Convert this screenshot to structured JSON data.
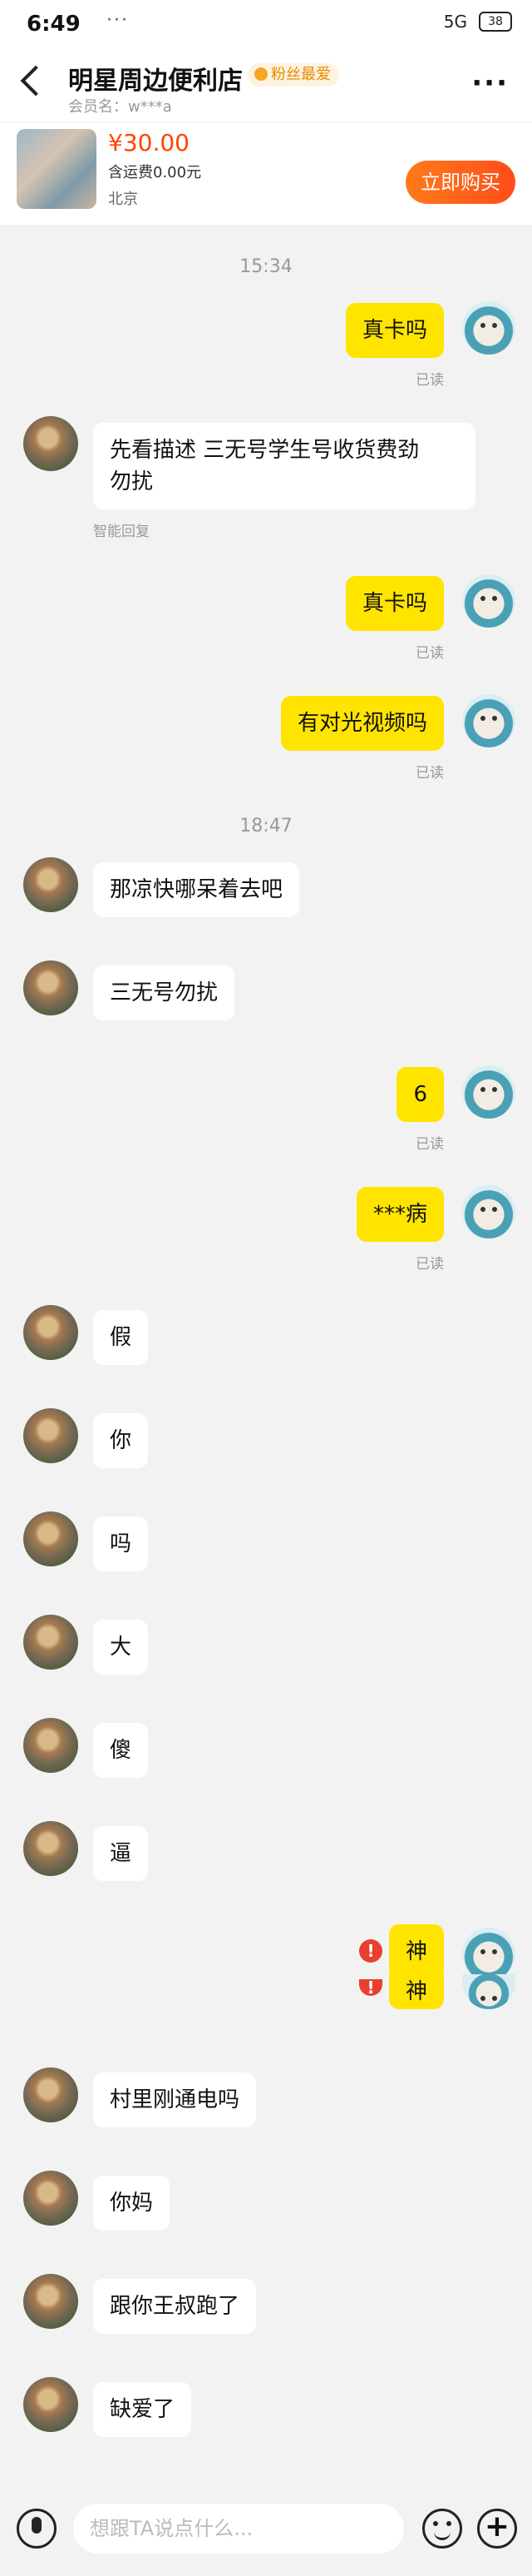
{
  "status_bar": {
    "time": "6:49",
    "extra": "··· ",
    "signal": "5G",
    "battery": "38"
  },
  "header": {
    "title": "明星周边便利店",
    "fan_badge": "粉丝最爱",
    "member": "会员名：w***a",
    "more": "···"
  },
  "product": {
    "price": "¥30.00",
    "shipping": "含运费0.00元",
    "location": "北京",
    "buy_label": "立即购买"
  },
  "chat": {
    "ts1": "15:34",
    "ts2": "18:47",
    "read": "已读",
    "auto_tag": "智能回复",
    "error_mark": "!",
    "m1": "真卡吗",
    "m2": "先看描述 三无号学生号收货费劲\n勿扰",
    "m3": "真卡吗",
    "m4": "有对光视频吗",
    "m5": "那凉快哪呆着去吧",
    "m6": "三无号勿扰",
    "m7": "6",
    "m8": "***病",
    "m9": "假",
    "m10": "你",
    "m11": "吗",
    "m12": "大",
    "m13": "傻",
    "m14": "逼",
    "m15": "神",
    "m16": "神",
    "m17": "村里刚通电吗",
    "m18": "你妈",
    "m19": "跟你王叔跑了",
    "m20": "缺爱了"
  },
  "input": {
    "placeholder": "想跟TA说点什么..."
  },
  "colors": {
    "accent": "#ffe400",
    "buy": "#ff4d1a",
    "price": "#ff4400",
    "error": "#e8402f"
  }
}
